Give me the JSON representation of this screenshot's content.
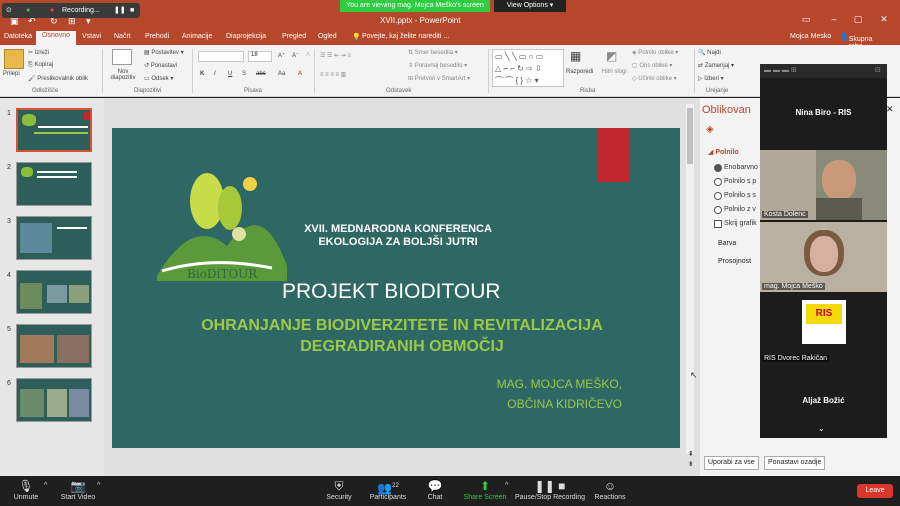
{
  "zoom_top": {
    "recording_label": "Recording...",
    "viewing_banner": "You are viewing mag. Mojca Meško's screen",
    "view_options": "View Options"
  },
  "window": {
    "title": "XVII.pptx  -  PowerPoint",
    "user": "Mojca Mesko",
    "share_label": "Skupna raba"
  },
  "menu": [
    "Datoteka",
    "Osnovno",
    "Vstavi",
    "Načrt",
    "Prehodi",
    "Animacije",
    "Diaprojekcija",
    "Pregled",
    "Ogled"
  ],
  "menu_active_index": 1,
  "tell_me": "Povejte, kaj želite narediti ...",
  "ribbon": {
    "clipboard": {
      "paste": "Prilepi",
      "cut": "Izreži",
      "copy": "Kopiraj",
      "format_painter": "Preslikovalnik oblik",
      "group": "Odložišče"
    },
    "slides": {
      "new_slide": "Nov diapozitiv",
      "layout": "Postavitev",
      "reset": "Ponastavi",
      "section": "Odsek",
      "group": "Diapozitivi"
    },
    "font": {
      "font_size": "18",
      "group": "Pisava",
      "bold": "K",
      "italic": "I",
      "underline": "U",
      "strike": "S",
      "abc": "abc",
      "aa": "Aa",
      "clear": "A"
    },
    "paragraph": {
      "text_direction": "Smer besedila",
      "align_text": "Poravnaj besedilo",
      "smartart": "Pretvori v SmartArt",
      "group": "Odstavek"
    },
    "drawing": {
      "arrange": "Razporedi",
      "quick_styles": "Hitri slogi",
      "fill": "Polnilo oblike",
      "outline": "Oris oblike",
      "effects": "Učinki oblike",
      "group": "Risba"
    },
    "editing": {
      "find": "Najdi",
      "replace": "Zamenjaj",
      "select": "Izberi",
      "group": "Urejanje"
    }
  },
  "thumbnails": [
    {
      "num": "1",
      "selected": true
    },
    {
      "num": "2",
      "selected": false
    },
    {
      "num": "3",
      "selected": false
    },
    {
      "num": "4",
      "selected": false
    },
    {
      "num": "5",
      "selected": false
    },
    {
      "num": "6",
      "selected": false
    }
  ],
  "slide": {
    "logo_text": "BioDiTOUR",
    "conference_line1": "XVII. MEDNARODNA KONFERENCA",
    "conference_line2": "EKOLOGIJA ZA BOLJŠI JUTRI",
    "project_title": "PROJEKT BIODITOUR",
    "subtitle_line1": "OHRANJANJE BIODIVERZITETE  IN REVITALIZACIJA",
    "subtitle_line2": "DEGRADIRANIH OBMOČIJ",
    "author_line1": "MAG. MOJCA MEŠKO,",
    "author_line2": "OBČINA KIDRIČEVO",
    "colors": {
      "background": "#2e6763",
      "accent": "#c0282d",
      "subtitle": "#9bc94a"
    }
  },
  "format_pane": {
    "title": "Oblikovan",
    "section": "Polnilo",
    "options": [
      "Enobarvno",
      "Polnilo s p",
      "Polnilo s s",
      "Polnilo z v"
    ],
    "checkbox": "Skrij grafik",
    "color_label": "Barva",
    "transparency_label": "Prosojnost",
    "apply_all": "Uporabi za vse",
    "reset_bg": "Ponastavi ozadje"
  },
  "participants": [
    {
      "name": "Nina Biro - RIS",
      "video": false
    },
    {
      "name": "Kosta Dolenc",
      "video": true
    },
    {
      "name": "mag. Mojca Meško",
      "video": true
    },
    {
      "name": "RIS Dvorec Rakičan",
      "video": false,
      "logo_text": "RIS"
    },
    {
      "name": "Aljaž Božić",
      "video": false
    }
  ],
  "toolbar": {
    "unmute": "Unmute",
    "start_video": "Start Video",
    "security": "Security",
    "participants": "Participants",
    "participants_count": "22",
    "chat": "Chat",
    "share_screen": "Share Screen",
    "pause_recording": "Pause/Stop Recording",
    "reactions": "Reactions",
    "leave": "Leave"
  }
}
